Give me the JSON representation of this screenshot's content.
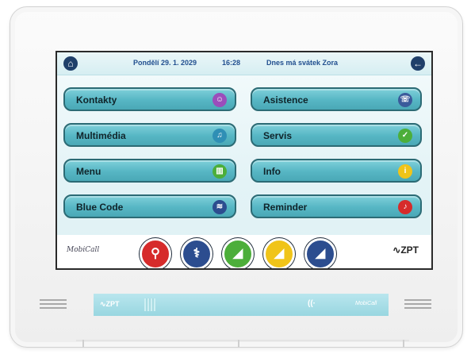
{
  "topbar": {
    "home_icon": "home-icon",
    "date": "Pondělí 29. 1. 2029",
    "time": "16:28",
    "nameday": "Dnes má svátek Zora",
    "back_icon": "back-arrow-icon"
  },
  "menu": {
    "left": [
      {
        "label": "Kontakty",
        "icon": "contacts-icon",
        "color": "#9b4dbb"
      },
      {
        "label": "Multimédia",
        "icon": "music-note-icon",
        "color": "#2f8fb5"
      },
      {
        "label": "Menu",
        "icon": "book-icon",
        "color": "#4cae3a"
      },
      {
        "label": "Blue Code",
        "icon": "wifi-icon",
        "color": "#2c4d8f"
      }
    ],
    "right": [
      {
        "label": "Asistence",
        "icon": "assistance-icon",
        "color": "#3a5b9b"
      },
      {
        "label": "Servis",
        "icon": "checkmark-icon",
        "color": "#4cae3a"
      },
      {
        "label": "Info",
        "icon": "info-icon",
        "color": "#f0c419"
      },
      {
        "label": "Reminder",
        "icon": "bell-icon",
        "color": "#d62b2b"
      }
    ]
  },
  "bottom_strip": {
    "brand_left": "MobiCall",
    "brand_right": "ZPT",
    "quick_icons": [
      {
        "icon": "emergency-person-icon",
        "color": "#d62b2b"
      },
      {
        "icon": "medical-caduceus-icon",
        "color": "#2c4d8f"
      },
      {
        "icon": "green-call-icon",
        "color": "#4cae3a"
      },
      {
        "icon": "yellow-call-icon",
        "color": "#f0c419"
      },
      {
        "icon": "blue-call-icon",
        "color": "#2c4d8f"
      }
    ]
  },
  "lower_panel": {
    "zpt": "ZPT",
    "call_symbol": "((·",
    "mobicall": "MobiCall"
  }
}
